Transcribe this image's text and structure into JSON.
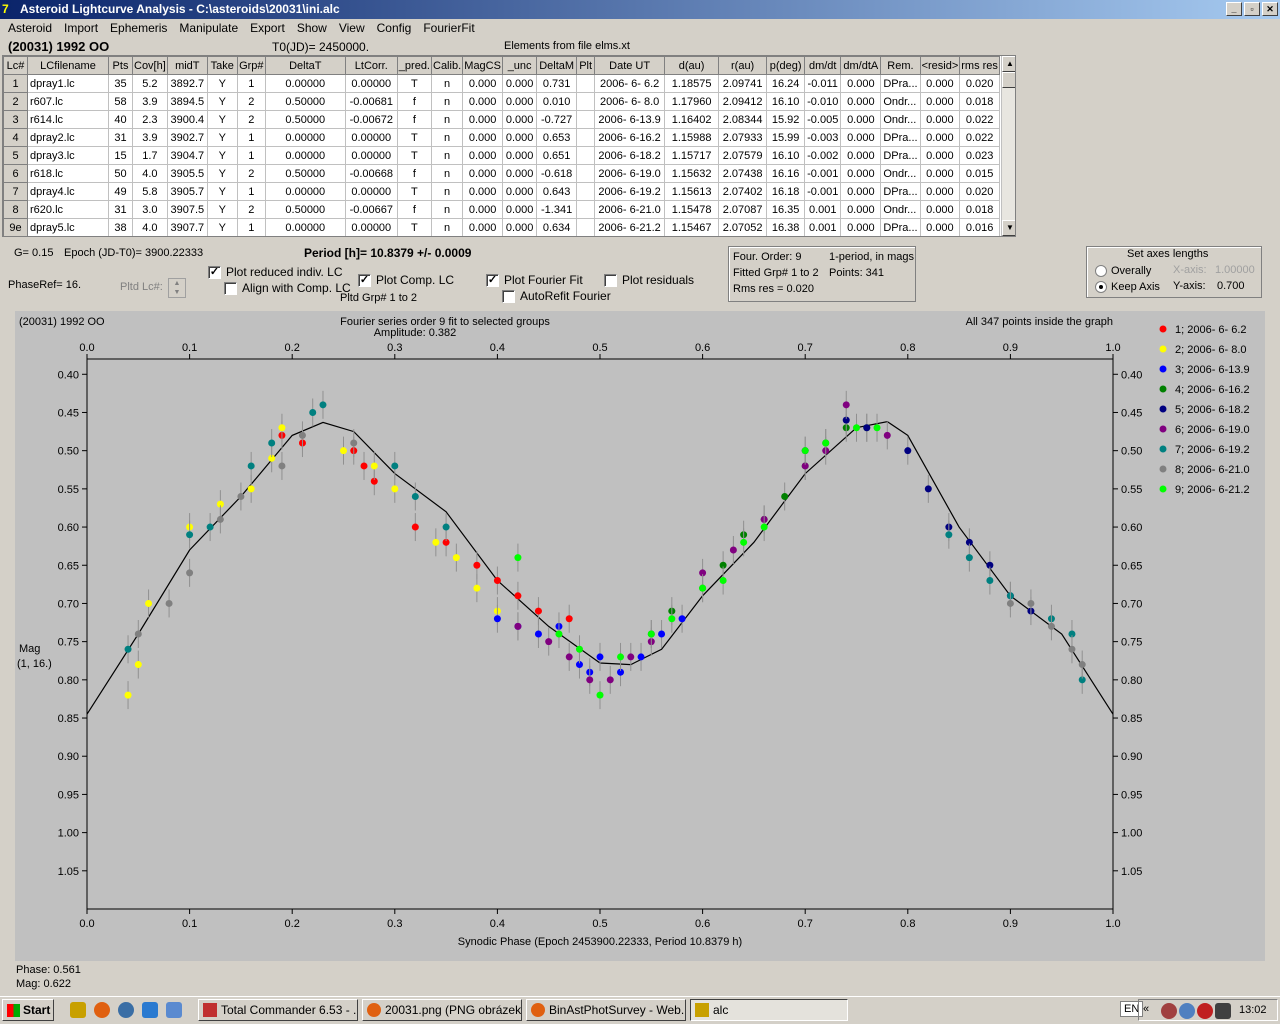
{
  "window": {
    "title": "Asteroid Lightcurve Analysis - C:\\asteroids\\20031\\ini.alc"
  },
  "menu": [
    "Asteroid",
    "Import",
    "Ephemeris",
    "Manipulate",
    "Export",
    "Show",
    "View",
    "Config",
    "FourierFit"
  ],
  "header": {
    "object": "(20031) 1992 OO",
    "t0": "T0(JD)= 2450000.",
    "elements": "Elements from file elms.xt"
  },
  "grid": {
    "columns": [
      "Lc#",
      "LCfilename",
      "Pts",
      "Cov[h]",
      "midT",
      "Take",
      "Grp#",
      "DeltaT",
      "LtCorr.",
      "_pred.",
      "Calib.",
      "MagCS",
      "_unc",
      "DeltaM",
      "Plt",
      "Date UT",
      "d(au)",
      "r(au)",
      "p(deg)",
      "dm/dt",
      "dm/dtA",
      "Rem.",
      "<resid>",
      "rms res"
    ],
    "rows": [
      [
        "1",
        "dpray1.lc",
        "35",
        "5.2",
        "3892.7",
        "Y",
        "1",
        "0.00000",
        "0.00000",
        "T",
        "n",
        "0.000",
        "0.000",
        "0.731",
        "",
        "2006- 6- 6.2",
        "1.18575",
        "2.09741",
        "16.24",
        "-0.011",
        "0.000",
        "DPra...",
        "0.000",
        "0.020"
      ],
      [
        "2",
        "r607.lc",
        "58",
        "3.9",
        "3894.5",
        "Y",
        "2",
        "0.50000",
        "-0.00681",
        "f",
        "n",
        "0.000",
        "0.000",
        "0.010",
        "",
        "2006- 6- 8.0",
        "1.17960",
        "2.09412",
        "16.10",
        "-0.010",
        "0.000",
        "Ondr...",
        "0.000",
        "0.018"
      ],
      [
        "3",
        "r614.lc",
        "40",
        "2.3",
        "3900.4",
        "Y",
        "2",
        "0.50000",
        "-0.00672",
        "f",
        "n",
        "0.000",
        "0.000",
        "-0.727",
        "",
        "2006- 6-13.9",
        "1.16402",
        "2.08344",
        "15.92",
        "-0.005",
        "0.000",
        "Ondr...",
        "0.000",
        "0.022"
      ],
      [
        "4",
        "dpray2.lc",
        "31",
        "3.9",
        "3902.7",
        "Y",
        "1",
        "0.00000",
        "0.00000",
        "T",
        "n",
        "0.000",
        "0.000",
        "0.653",
        "",
        "2006- 6-16.2",
        "1.15988",
        "2.07933",
        "15.99",
        "-0.003",
        "0.000",
        "DPra...",
        "0.000",
        "0.022"
      ],
      [
        "5",
        "dpray3.lc",
        "15",
        "1.7",
        "3904.7",
        "Y",
        "1",
        "0.00000",
        "0.00000",
        "T",
        "n",
        "0.000",
        "0.000",
        "0.651",
        "",
        "2006- 6-18.2",
        "1.15717",
        "2.07579",
        "16.10",
        "-0.002",
        "0.000",
        "DPra...",
        "0.000",
        "0.023"
      ],
      [
        "6",
        "r618.lc",
        "50",
        "4.0",
        "3905.5",
        "Y",
        "2",
        "0.50000",
        "-0.00668",
        "f",
        "n",
        "0.000",
        "0.000",
        "-0.618",
        "",
        "2006- 6-19.0",
        "1.15632",
        "2.07438",
        "16.16",
        "-0.001",
        "0.000",
        "Ondr...",
        "0.000",
        "0.015"
      ],
      [
        "7",
        "dpray4.lc",
        "49",
        "5.8",
        "3905.7",
        "Y",
        "1",
        "0.00000",
        "0.00000",
        "T",
        "n",
        "0.000",
        "0.000",
        "0.643",
        "",
        "2006- 6-19.2",
        "1.15613",
        "2.07402",
        "16.18",
        "-0.001",
        "0.000",
        "DPra...",
        "0.000",
        "0.020"
      ],
      [
        "8",
        "r620.lc",
        "31",
        "3.0",
        "3907.5",
        "Y",
        "2",
        "0.50000",
        "-0.00667",
        "f",
        "n",
        "0.000",
        "0.000",
        "-1.341",
        "",
        "2006- 6-21.0",
        "1.15478",
        "2.07087",
        "16.35",
        "0.001",
        "0.000",
        "Ondr...",
        "0.000",
        "0.018"
      ],
      [
        "9e",
        "dpray5.lc",
        "38",
        "4.0",
        "3907.7",
        "Y",
        "1",
        "0.00000",
        "0.00000",
        "T",
        "n",
        "0.000",
        "0.000",
        "0.634",
        "",
        "2006- 6-21.2",
        "1.15467",
        "2.07052",
        "16.38",
        "0.001",
        "0.000",
        "DPra...",
        "0.000",
        "0.016"
      ]
    ]
  },
  "controls": {
    "g": "G= 0.15",
    "epoch": "Epoch (JD-T0)= 3900.22333",
    "period": "Period [h]= 10.8379 +/- 0.0009",
    "phaseref": "PhaseRef= 16.",
    "pltd_lc": "Pltd Lc#:",
    "plot_reduced": "Plot reduced indiv. LC",
    "align_comp": "Align with Comp. LC",
    "plot_comp": "Plot Comp. LC",
    "pltd_grp": "Pltd Grp#  1   to   2",
    "plot_fourier": "Plot Fourier Fit",
    "autorefit": "AutoRefit Fourier",
    "plot_resid": "Plot residuals",
    "four_order": "Four. Order:  9",
    "one_period": "1-period, in mags",
    "fitted_grp": "Fitted Grp# 1 to 2",
    "points": "Points: 341",
    "rms": "Rms res       = 0.020",
    "axes_title": "Set axes lengths",
    "overally": "Overally",
    "keep_axis": "Keep Axis",
    "xaxis_label": "X-axis:",
    "xaxis_val": "1.00000",
    "yaxis_label": "Y-axis:",
    "yaxis_val": "0.700"
  },
  "chart_data": {
    "type": "scatter",
    "title": "Fourier series order 9 fit to selected groups",
    "subtitle": "Amplitude: 0.382",
    "object_label": "(20031) 1992 OO",
    "status": "All 347 points inside the graph",
    "xlabel": "Synodic Phase (Epoch 2453900.22333, Period 10.8379 h)",
    "ylabel": "Mag\n(1, 16.)",
    "xlim": [
      0,
      1
    ],
    "ylim": [
      1.1,
      0.38
    ],
    "xticks": [
      "0.0",
      "0.1",
      "0.2",
      "0.3",
      "0.4",
      "0.5",
      "0.6",
      "0.7",
      "0.8",
      "0.9",
      "1.0"
    ],
    "yticks": [
      "0.40",
      "0.45",
      "0.50",
      "0.55",
      "0.60",
      "0.65",
      "0.70",
      "0.75",
      "0.80",
      "0.85",
      "0.90",
      "0.95",
      "1.00",
      "1.05"
    ],
    "fit_curve": [
      [
        0,
        0.845
      ],
      [
        0.05,
        0.74
      ],
      [
        0.1,
        0.63
      ],
      [
        0.15,
        0.56
      ],
      [
        0.2,
        0.48
      ],
      [
        0.23,
        0.463
      ],
      [
        0.26,
        0.475
      ],
      [
        0.3,
        0.53
      ],
      [
        0.35,
        0.58
      ],
      [
        0.4,
        0.67
      ],
      [
        0.45,
        0.73
      ],
      [
        0.5,
        0.778
      ],
      [
        0.53,
        0.78
      ],
      [
        0.56,
        0.76
      ],
      [
        0.6,
        0.69
      ],
      [
        0.65,
        0.62
      ],
      [
        0.7,
        0.53
      ],
      [
        0.75,
        0.47
      ],
      [
        0.78,
        0.462
      ],
      [
        0.8,
        0.48
      ],
      [
        0.85,
        0.6
      ],
      [
        0.9,
        0.69
      ],
      [
        0.95,
        0.74
      ],
      [
        1.0,
        0.845
      ]
    ],
    "series": [
      {
        "name": "1; 2006- 6- 6.2",
        "color": "#ff0000",
        "points": [
          [
            0.19,
            0.48
          ],
          [
            0.21,
            0.49
          ],
          [
            0.26,
            0.5
          ],
          [
            0.27,
            0.52
          ],
          [
            0.28,
            0.54
          ],
          [
            0.32,
            0.6
          ],
          [
            0.35,
            0.62
          ],
          [
            0.38,
            0.65
          ],
          [
            0.4,
            0.67
          ],
          [
            0.42,
            0.69
          ],
          [
            0.44,
            0.71
          ],
          [
            0.47,
            0.72
          ]
        ]
      },
      {
        "name": "2; 2006- 6- 8.0",
        "color": "#ffff00",
        "points": [
          [
            0.04,
            0.82
          ],
          [
            0.05,
            0.78
          ],
          [
            0.06,
            0.7
          ],
          [
            0.1,
            0.6
          ],
          [
            0.13,
            0.57
          ],
          [
            0.16,
            0.55
          ],
          [
            0.18,
            0.51
          ],
          [
            0.19,
            0.47
          ],
          [
            0.25,
            0.5
          ],
          [
            0.28,
            0.52
          ],
          [
            0.3,
            0.55
          ],
          [
            0.34,
            0.62
          ],
          [
            0.36,
            0.64
          ],
          [
            0.38,
            0.68
          ],
          [
            0.4,
            0.71
          ]
        ]
      },
      {
        "name": "3; 2006- 6-13.9",
        "color": "#0000ff",
        "points": [
          [
            0.4,
            0.72
          ],
          [
            0.42,
            0.73
          ],
          [
            0.44,
            0.74
          ],
          [
            0.46,
            0.73
          ],
          [
            0.48,
            0.78
          ],
          [
            0.49,
            0.79
          ],
          [
            0.5,
            0.77
          ],
          [
            0.52,
            0.79
          ],
          [
            0.54,
            0.77
          ],
          [
            0.56,
            0.74
          ],
          [
            0.58,
            0.72
          ]
        ]
      },
      {
        "name": "4; 2006- 6-16.2",
        "color": "#008000",
        "points": [
          [
            0.55,
            0.74
          ],
          [
            0.57,
            0.71
          ],
          [
            0.6,
            0.68
          ],
          [
            0.62,
            0.65
          ],
          [
            0.64,
            0.61
          ],
          [
            0.66,
            0.59
          ],
          [
            0.68,
            0.56
          ],
          [
            0.7,
            0.52
          ],
          [
            0.72,
            0.49
          ],
          [
            0.74,
            0.47
          ],
          [
            0.76,
            0.47
          ]
        ]
      },
      {
        "name": "5; 2006- 6-18.2",
        "color": "#000080",
        "points": [
          [
            0.7,
            0.5
          ],
          [
            0.74,
            0.46
          ],
          [
            0.76,
            0.47
          ],
          [
            0.8,
            0.5
          ],
          [
            0.82,
            0.55
          ],
          [
            0.84,
            0.6
          ],
          [
            0.86,
            0.62
          ],
          [
            0.88,
            0.65
          ],
          [
            0.9,
            0.69
          ],
          [
            0.92,
            0.71
          ]
        ]
      },
      {
        "name": "6; 2006- 6-19.0",
        "color": "#800080",
        "points": [
          [
            0.42,
            0.73
          ],
          [
            0.45,
            0.75
          ],
          [
            0.47,
            0.77
          ],
          [
            0.49,
            0.8
          ],
          [
            0.51,
            0.8
          ],
          [
            0.53,
            0.77
          ],
          [
            0.55,
            0.75
          ],
          [
            0.6,
            0.66
          ],
          [
            0.63,
            0.63
          ],
          [
            0.66,
            0.59
          ],
          [
            0.7,
            0.52
          ],
          [
            0.72,
            0.5
          ],
          [
            0.74,
            0.44
          ],
          [
            0.78,
            0.48
          ]
        ]
      },
      {
        "name": "7; 2006- 6-19.2",
        "color": "#008080",
        "points": [
          [
            0.04,
            0.76
          ],
          [
            0.1,
            0.61
          ],
          [
            0.12,
            0.6
          ],
          [
            0.16,
            0.52
          ],
          [
            0.18,
            0.49
          ],
          [
            0.22,
            0.45
          ],
          [
            0.23,
            0.44
          ],
          [
            0.3,
            0.52
          ],
          [
            0.32,
            0.56
          ],
          [
            0.35,
            0.6
          ],
          [
            0.84,
            0.61
          ],
          [
            0.86,
            0.64
          ],
          [
            0.88,
            0.67
          ],
          [
            0.9,
            0.69
          ],
          [
            0.94,
            0.72
          ],
          [
            0.96,
            0.74
          ],
          [
            0.97,
            0.8
          ]
        ]
      },
      {
        "name": "8; 2006- 6-21.0",
        "color": "#808080",
        "points": [
          [
            0.05,
            0.74
          ],
          [
            0.08,
            0.7
          ],
          [
            0.1,
            0.66
          ],
          [
            0.13,
            0.59
          ],
          [
            0.15,
            0.56
          ],
          [
            0.19,
            0.52
          ],
          [
            0.21,
            0.48
          ],
          [
            0.26,
            0.49
          ],
          [
            0.9,
            0.7
          ],
          [
            0.92,
            0.7
          ],
          [
            0.94,
            0.73
          ],
          [
            0.96,
            0.76
          ],
          [
            0.97,
            0.78
          ]
        ]
      },
      {
        "name": "9; 2006- 6-21.2",
        "color": "#00ff00",
        "points": [
          [
            0.42,
            0.64
          ],
          [
            0.46,
            0.74
          ],
          [
            0.48,
            0.76
          ],
          [
            0.5,
            0.82
          ],
          [
            0.52,
            0.77
          ],
          [
            0.55,
            0.74
          ],
          [
            0.57,
            0.72
          ],
          [
            0.6,
            0.68
          ],
          [
            0.62,
            0.67
          ],
          [
            0.64,
            0.62
          ],
          [
            0.66,
            0.6
          ],
          [
            0.7,
            0.5
          ],
          [
            0.72,
            0.49
          ],
          [
            0.75,
            0.47
          ],
          [
            0.77,
            0.47
          ]
        ]
      }
    ],
    "readout": {
      "phase": "Phase: 0.561",
      "mag": "Mag:   0.622"
    }
  },
  "taskbar": {
    "start": "Start",
    "tasks": [
      "Total Commander 6.53 - ...",
      "20031.png (PNG obrázek...",
      "BinAstPhotSurvey - Web...",
      "alc"
    ],
    "lang": "EN",
    "time": "13:02"
  }
}
